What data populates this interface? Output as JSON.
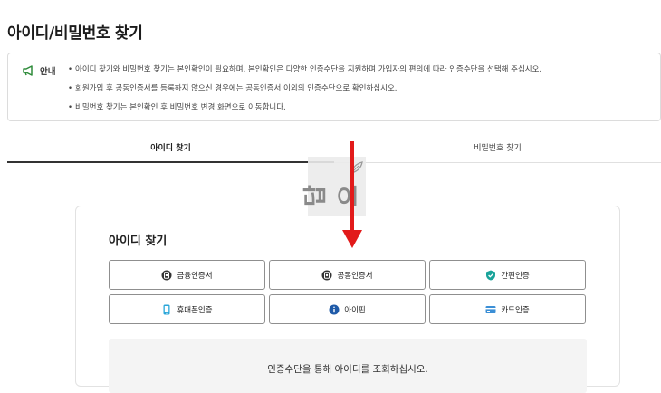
{
  "page": {
    "title": "아이디/비밀번호 찾기"
  },
  "notice": {
    "label": "안내",
    "items": [
      "아이디 찾기와 비밀번호 찾기는 본인확인이 필요하며, 본인확인은 다양한 인증수단을 지원하며 가입자의 편의에 따라 인증수단을 선택해 주십시오.",
      "회원가입 후 공동인증서를 등록하지 않으신 경우에는 공동인증서 이외의 인증수단으로 확인하십시오.",
      "비밀번호 찾기는 본인확인 후 비밀번호 변경 화면으로 이동합니다."
    ]
  },
  "tabs": [
    {
      "label": "아이디 찾기",
      "active": true
    },
    {
      "label": "비밀번호 찾기",
      "active": false
    }
  ],
  "watermark": {
    "text": "답오"
  },
  "card": {
    "title": "아이디 찾기",
    "buttons": [
      {
        "label": "금융인증서",
        "icon": "financial-cert-icon"
      },
      {
        "label": "공동인증서",
        "icon": "joint-cert-icon"
      },
      {
        "label": "간편인증",
        "icon": "simple-auth-check-icon"
      },
      {
        "label": "휴대폰인증",
        "icon": "mobile-phone-icon"
      },
      {
        "label": "아이핀",
        "icon": "ipin-info-icon"
      },
      {
        "label": "카드인증",
        "icon": "card-icon"
      }
    ],
    "result_text": "인증수단을 통해 아이디를 조회하십시오."
  },
  "colors": {
    "arrow": "#e21a1a",
    "notice_icon": "#2e8b3a",
    "simple_auth": "#1aa39a",
    "mobile": "#2aa6d8",
    "ipin": "#1e5aa8",
    "card": "#3b8fd6",
    "cert_dark": "#333333"
  }
}
